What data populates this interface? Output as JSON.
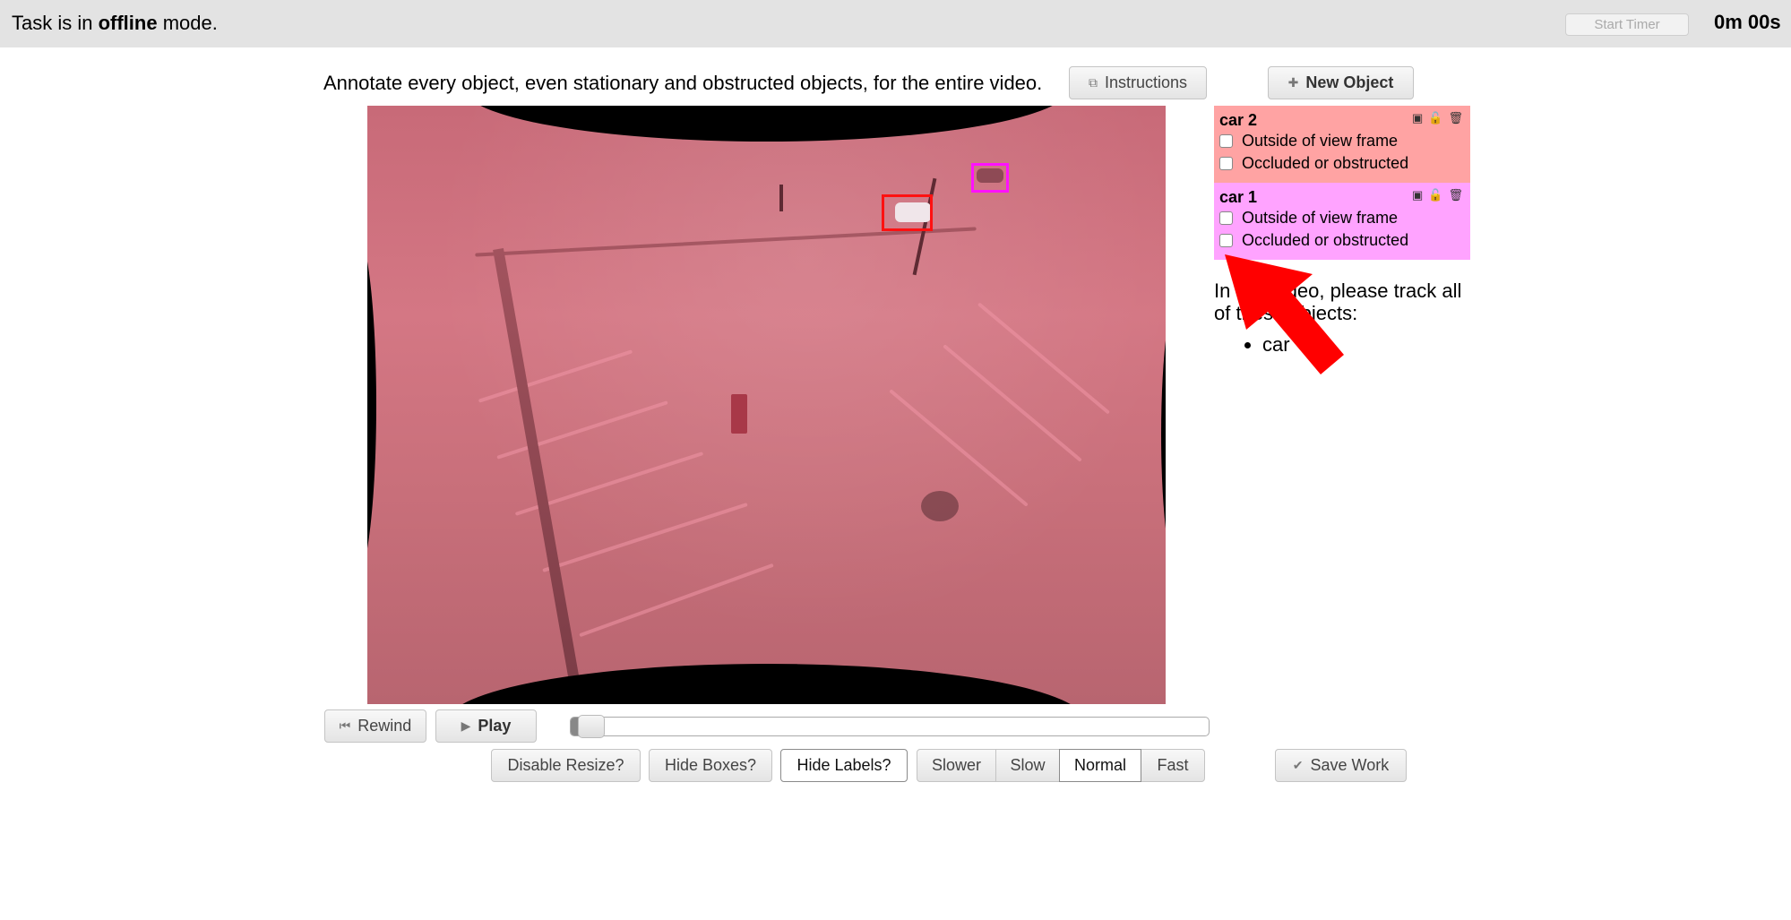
{
  "topbar": {
    "status_prefix": "Task is in ",
    "status_mode": "offline",
    "status_suffix": " mode.",
    "start_timer_label": "Start Timer",
    "timer": "0m 00s"
  },
  "prompt": "Annotate every object, even stationary and obstructed objects, for the entire video.",
  "instructions_label": "Instructions",
  "new_object_label": "New Object",
  "objects": [
    {
      "name": "car 2",
      "color": "#ffa3a3",
      "box_color": "#ff1111",
      "options": [
        "Outside of view frame",
        "Occluded or obstructed"
      ]
    },
    {
      "name": "car 1",
      "color": "#ffa3ff",
      "box_color": "#ff11ff",
      "options": [
        "Outside of view frame",
        "Occluded or obstructed"
      ]
    }
  ],
  "track_text": "In this video, please track all of these objects:",
  "track_items": [
    "car"
  ],
  "playback": {
    "rewind_label": "Rewind",
    "play_label": "Play",
    "progress": 0
  },
  "toggles": {
    "disable_resize": "Disable Resize?",
    "hide_boxes": "Hide Boxes?",
    "hide_labels": "Hide Labels?"
  },
  "speeds": [
    "Slower",
    "Slow",
    "Normal",
    "Fast"
  ],
  "selected_speed": "Normal",
  "save_label": "Save Work",
  "annotation_arrow_color": "#ff0000"
}
